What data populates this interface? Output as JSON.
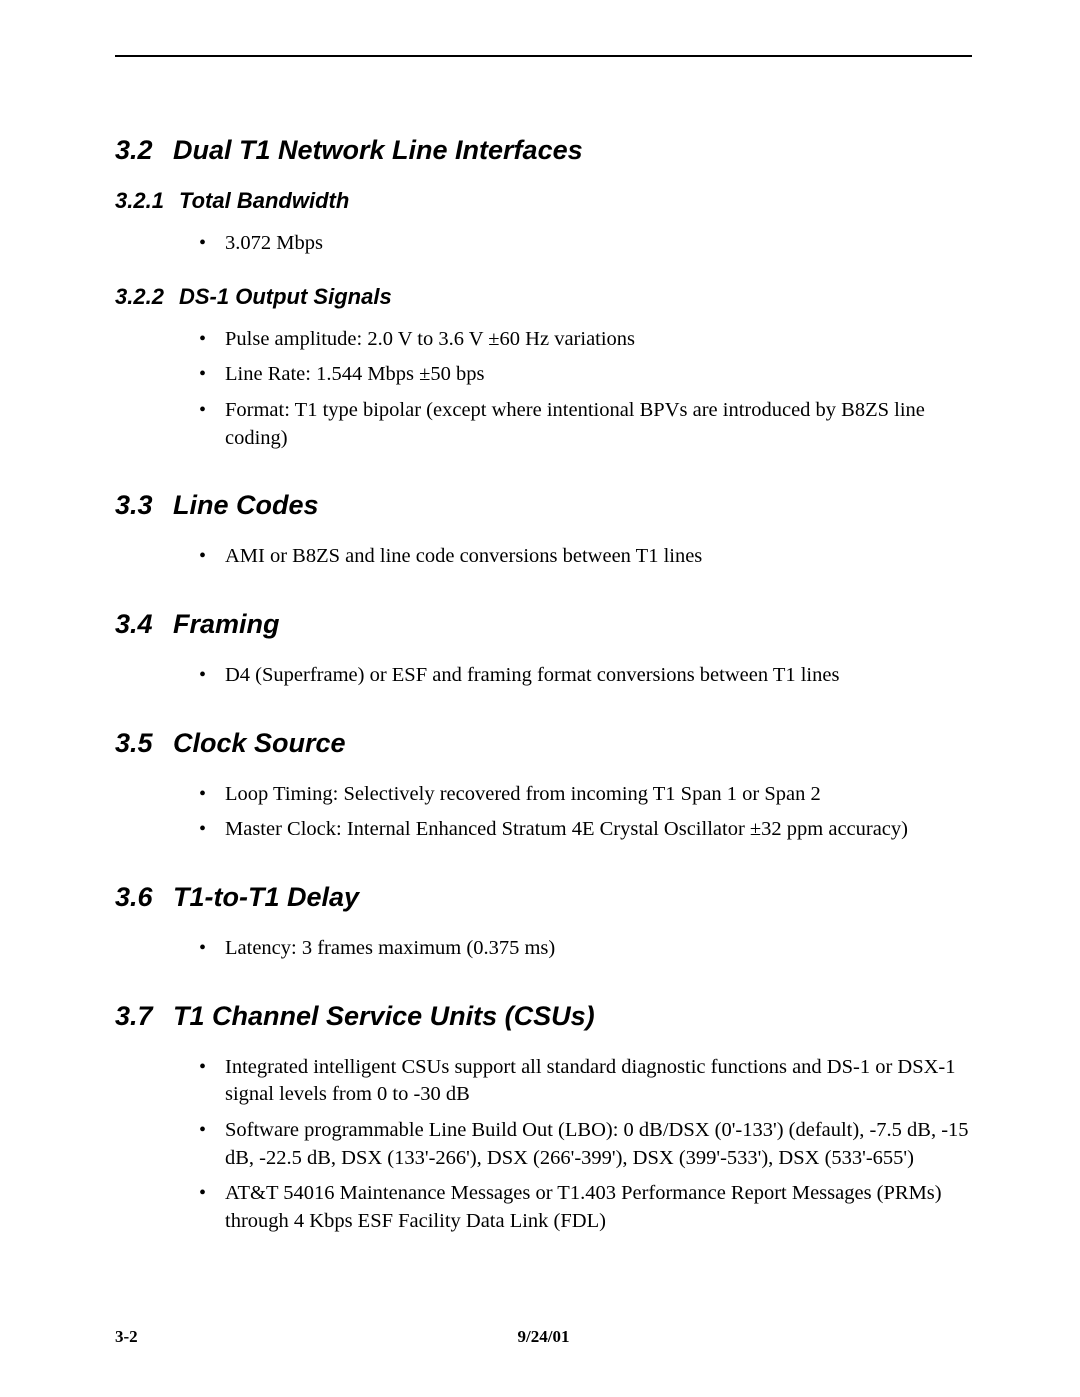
{
  "sections": {
    "s32": {
      "num": "3.2",
      "title": "Dual T1 Network Line Interfaces"
    },
    "s321": {
      "num": "3.2.1",
      "title": "Total Bandwidth",
      "items": [
        "3.072 Mbps"
      ]
    },
    "s322": {
      "num": "3.2.2",
      "title": "DS-1 Output Signals",
      "items": [
        "Pulse amplitude: 2.0 V to 3.6 V ±60 Hz variations",
        "Line Rate: 1.544 Mbps ±50 bps",
        "Format: T1 type bipolar (except where intentional BPVs are introduced by B8ZS line coding)"
      ]
    },
    "s33": {
      "num": "3.3",
      "title": "Line Codes",
      "items": [
        "AMI or B8ZS and line code conversions between T1 lines"
      ]
    },
    "s34": {
      "num": "3.4",
      "title": "Framing",
      "items": [
        "D4 (Superframe) or ESF and framing format conversions between T1 lines"
      ]
    },
    "s35": {
      "num": "3.5",
      "title": "Clock Source",
      "items": [
        "Loop Timing: Selectively recovered from incoming T1 Span 1 or Span 2",
        "Master Clock: Internal Enhanced Stratum 4E Crystal Oscillator ±32 ppm accuracy)"
      ]
    },
    "s36": {
      "num": "3.6",
      "title": "T1-to-T1 Delay",
      "items": [
        "Latency: 3 frames maximum (0.375 ms)"
      ]
    },
    "s37": {
      "num": "3.7",
      "title": "T1 Channel Service Units (CSUs)",
      "items": [
        "Integrated intelligent CSUs support all standard diagnostic functions and DS-1 or DSX-1 signal levels from 0 to -30 dB",
        "Software programmable Line Build Out (LBO): 0 dB/DSX (0'-133') (default), -7.5 dB, -15 dB, -22.5 dB, DSX (133'-266'), DSX (266'-399'), DSX (399'-533'), DSX (533'-655')",
        "AT&T 54016 Maintenance Messages or T1.403 Performance Report Messages (PRMs) through 4 Kbps ESF Facility Data Link (FDL)"
      ]
    }
  },
  "footer": {
    "left": "3-2",
    "center": "9/24/01"
  }
}
